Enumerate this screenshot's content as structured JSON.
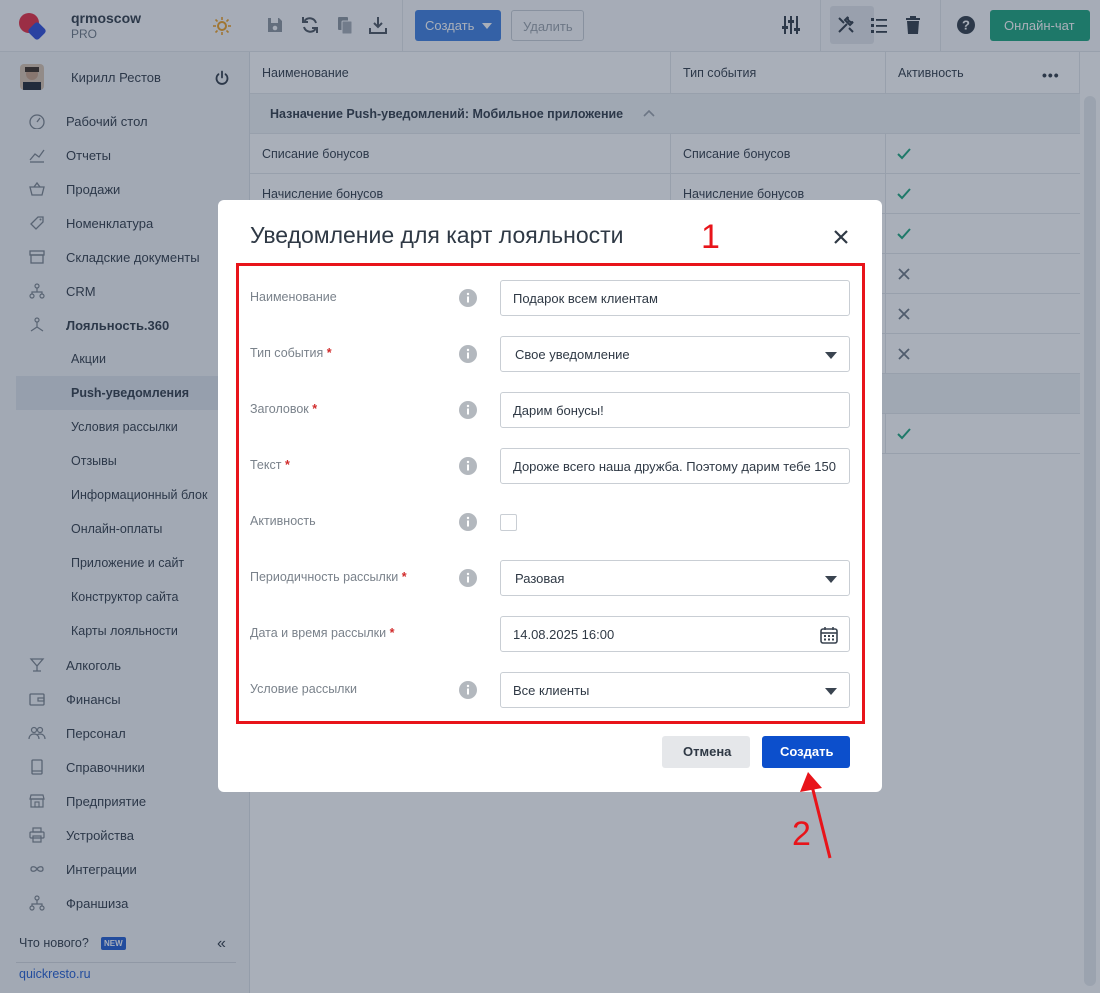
{
  "brand": {
    "name": "qrmoscow",
    "plan": "PRO"
  },
  "user": {
    "name": "Кирилл Рестов"
  },
  "sidebar": {
    "items": [
      {
        "label": "Рабочий стол",
        "icon": "dashboard-icon"
      },
      {
        "label": "Отчеты",
        "icon": "chart-icon"
      },
      {
        "label": "Продажи",
        "icon": "basket-icon"
      },
      {
        "label": "Номенклатура",
        "icon": "tag-icon"
      },
      {
        "label": "Складские документы",
        "icon": "archive-icon"
      },
      {
        "label": "CRM",
        "icon": "crm-icon"
      },
      {
        "label": "Лояльность.360",
        "icon": "loyalty-icon"
      }
    ],
    "subitems": [
      {
        "label": "Акции"
      },
      {
        "label": "Push-уведомления"
      },
      {
        "label": "Условия рассылки"
      },
      {
        "label": "Отзывы"
      },
      {
        "label": "Информационный блок"
      },
      {
        "label": "Онлайн-оплаты"
      },
      {
        "label": "Приложение и сайт"
      },
      {
        "label": "Конструктор сайта"
      },
      {
        "label": "Карты лояльности"
      }
    ],
    "items2": [
      {
        "label": "Алкоголь",
        "icon": "glass-icon"
      },
      {
        "label": "Финансы",
        "icon": "wallet-icon"
      },
      {
        "label": "Персонал",
        "icon": "people-icon"
      },
      {
        "label": "Справочники",
        "icon": "book-icon"
      },
      {
        "label": "Предприятие",
        "icon": "store-icon"
      },
      {
        "label": "Устройства",
        "icon": "printer-icon"
      },
      {
        "label": "Интеграции",
        "icon": "infinity-icon"
      },
      {
        "label": "Франшиза",
        "icon": "franchise-icon"
      }
    ],
    "whats_new": "Что нового?",
    "new_badge": "NEW",
    "site": "quickresto.ru"
  },
  "toolbar": {
    "create": "Создать",
    "delete": "Удалить",
    "chat": "Онлайн-чат"
  },
  "grid": {
    "columns": [
      "Наименование",
      "Тип события",
      "Активность"
    ],
    "group": "Назначение Push-уведомлений: Мобильное приложение",
    "rows": [
      {
        "name": "Списание бонусов",
        "type": "Списание бонусов",
        "active": true
      },
      {
        "name": "Начисление бонусов",
        "type": "Начисление бонусов",
        "active": true
      }
    ],
    "hidden_marks": [
      true,
      false,
      false,
      false
    ],
    "lower_mark": true
  },
  "modal": {
    "title": "Уведомление для карт лояльности",
    "fields": [
      {
        "label": "Наименование",
        "required": false,
        "value": "Подарок всем клиентам",
        "kind": "text"
      },
      {
        "label": "Тип события",
        "required": true,
        "value": "Свое уведомление",
        "kind": "select"
      },
      {
        "label": "Заголовок",
        "required": true,
        "value": "Дарим бонусы!",
        "kind": "text"
      },
      {
        "label": "Текст",
        "required": true,
        "value": "Дороже всего наша дружба. Поэтому дарим тебе 150",
        "kind": "text"
      },
      {
        "label": "Активность",
        "required": false,
        "value": "",
        "kind": "checkbox"
      },
      {
        "label": "Периодичность рассылки",
        "required": true,
        "value": "Разовая",
        "kind": "select"
      },
      {
        "label": "Дата и время рассылки",
        "required": true,
        "value": "14.08.2025 16:00",
        "kind": "date"
      },
      {
        "label": "Условие рассылки",
        "required": false,
        "value": "Все клиенты",
        "kind": "select"
      }
    ],
    "cancel": "Отмена",
    "submit": "Создать"
  },
  "annotations": {
    "step1": "1",
    "step2": "2",
    "color": "#e8141a"
  }
}
